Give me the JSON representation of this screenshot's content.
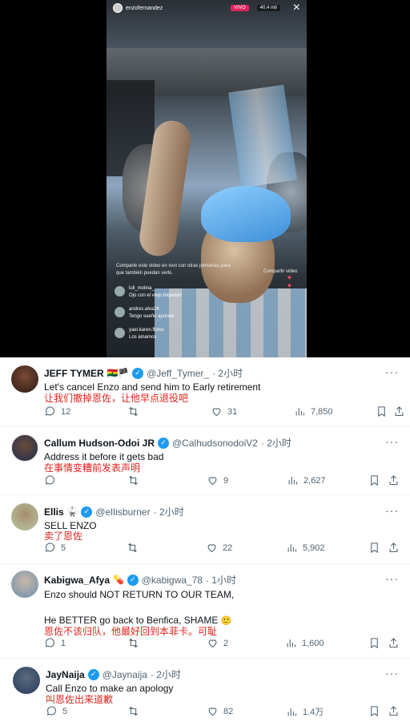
{
  "video": {
    "username": "enzofernandez",
    "live_label": "VIVO",
    "viewers": "40.4 mil",
    "close": "×",
    "share_text": "Comparte este video en vivo con otras personas para que también puedan verlo.",
    "share_right": "Compartir video",
    "hearts": "♥\n♥",
    "comments": [
      {
        "user": "lull_molina_",
        "text": "Ojo con el viejo toqueton"
      },
      {
        "user": "andres.alva24",
        "text": "Tengo sueño apúrate"
      },
      {
        "user": "yaei.karen.flores",
        "text": "Los amamos"
      }
    ]
  },
  "tweets": [
    {
      "name": "JEFF TYMER",
      "flags": "🇬🇭🏴",
      "handle": "@Jeff_Tymer_",
      "time": "· 2小时",
      "text": "Let's cancel Enzo and send him to Early retirement",
      "translation": "让我们撤掉恩佐，让他早点退役吧",
      "replies": "12",
      "retweets": "",
      "likes": "31",
      "views": "7,850"
    },
    {
      "name": "Callum Hudson-Odoi JR",
      "handle": "@CalhudsonodoiV2",
      "time": "· 2小时",
      "text": "Address it before it gets bad",
      "translation": "在事情变糟前发表声明",
      "replies": "",
      "retweets": "",
      "likes": "9",
      "views": "2,627"
    },
    {
      "name": "Ellis",
      "flags": "🥋",
      "handle": "@elIisburner",
      "time": "· 2小时",
      "text": "SELL ENZO",
      "translation": "卖了恩佐",
      "replies": "5",
      "retweets": "",
      "likes": "22",
      "views": "5,902"
    },
    {
      "name": "Kabigwa_Afya",
      "flags": "💊",
      "handle": "@kabigwa_78",
      "time": "· 1小时",
      "text": "Enzo should NOT RETURN TO OUR TEAM,",
      "text2": "He BETTER go back to Benfica, SHAME",
      "emoji": "🙂",
      "translation": "恩佐不该归队，他最好回到本菲卡。可耻",
      "replies": "1",
      "retweets": "",
      "likes": "2",
      "views": "1,600"
    },
    {
      "name": "JayNaija",
      "handle": "@Jaynaija",
      "time": "· 2小时",
      "text": "Call Enzo to make an apology",
      "translation": "叫恩佐出来道歉",
      "replies": "5",
      "retweets": "",
      "likes": "82",
      "views": "1.4万"
    }
  ],
  "colors": {
    "accent": "#1d9bf0",
    "translation": "#e0241c",
    "meta": "#536471"
  }
}
